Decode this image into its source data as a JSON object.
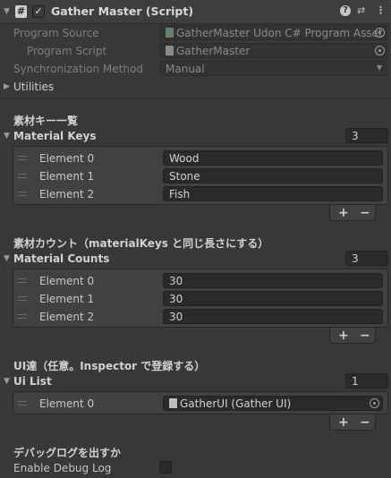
{
  "header": {
    "title": "Gather Master (Script)",
    "enabled": true
  },
  "program": {
    "source_label": "Program Source",
    "source_value": "GatherMaster Udon C# Program Asset (",
    "script_label": "Program Script",
    "script_value": "GatherMaster",
    "sync_label": "Synchronization Method",
    "sync_value": "Manual",
    "utilities_label": "Utilities"
  },
  "keys_section": {
    "header": "素材キー一覧",
    "title": "Material Keys",
    "size": "3",
    "elements": [
      {
        "label": "Element 0",
        "value": "Wood"
      },
      {
        "label": "Element 1",
        "value": "Stone"
      },
      {
        "label": "Element 2",
        "value": "Fish"
      }
    ]
  },
  "counts_section": {
    "header": "素材カウント（materialKeys と同じ長さにする）",
    "title": "Material Counts",
    "size": "3",
    "elements": [
      {
        "label": "Element 0",
        "value": "30"
      },
      {
        "label": "Element 1",
        "value": "30"
      },
      {
        "label": "Element 2",
        "value": "30"
      }
    ]
  },
  "ui_section": {
    "header": "UI達（任意。Inspector で登録する）",
    "title": "Ui List",
    "size": "1",
    "elements": [
      {
        "label": "Element 0",
        "value": "GatherUI (Gather UI)"
      }
    ]
  },
  "debug_section": {
    "header": "デバッグログを出すか",
    "label": "Enable Debug Log",
    "checked": false
  },
  "buttons": {
    "plus": "+",
    "minus": "−"
  },
  "glyphs": {
    "hash": "#",
    "check": "✓",
    "help": "?",
    "presets": "⇄",
    "more": "⋮",
    "fold_open": "▼",
    "fold_closed": "▶",
    "dropdown": "▼"
  }
}
